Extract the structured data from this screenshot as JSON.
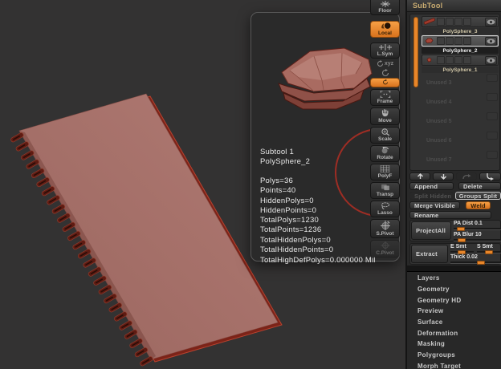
{
  "popup": {
    "subtool_label": "Subtool 1",
    "subtool_name": "PolySphere_2",
    "stats": [
      "Polys=36",
      "Points=40",
      "HiddenPolys=0",
      "HiddenPoints=0"
    ],
    "totals": [
      "TotalPolys=1230",
      "TotalPoints=1236",
      "TotalHiddenPolys=0",
      "TotalHiddenPoints=0",
      "TotalHighDefPolys=0.000000 Mil"
    ]
  },
  "toolbar": {
    "labels": {
      "floor": "Floor",
      "local": "Local",
      "lsym": "L.Sym",
      "xyz": "xyz",
      "frame": "Frame",
      "move": "Move",
      "scale": "Scale",
      "rotate": "Rotate",
      "polyf": "PolyF",
      "transp": "Transp",
      "lasso": "Lasso",
      "spivot": "S.Pivot",
      "cpivot": "C.Pivot"
    }
  },
  "sidebar": {
    "title": "SubTool",
    "subtools": [
      {
        "name": "PolySphere_3"
      },
      {
        "name": "PolySphere_2"
      },
      {
        "name": "PolySphere_1"
      }
    ],
    "unused": [
      "Unused 3",
      "Unused 4",
      "Unused 5",
      "Unused 6",
      "Unused 7"
    ],
    "actions": {
      "append": "Append",
      "delete": "Delete",
      "split_hidden": "Split Hidden",
      "groups_split": "Groups Split",
      "merge_visible": "Merge Visible",
      "weld": "Weld",
      "rename": "Rename",
      "project_all": "ProjectAll",
      "extract": "Extract"
    },
    "sliders": {
      "pa_dist": "PA Dist 0.1",
      "pa_blur": "PA Blur 10",
      "e_smt": "E Smt",
      "s_smt": "S Smt",
      "thick": "Thick 0.02"
    },
    "menu": [
      "Layers",
      "Geometry",
      "Geometry HD",
      "Preview",
      "Surface",
      "Deformation",
      "Masking",
      "Polygroups",
      "Morph Target"
    ]
  },
  "colors": {
    "accent_orange": "#e8862a",
    "model_red": "#a5706a",
    "ring_red": "#9e2d24"
  }
}
